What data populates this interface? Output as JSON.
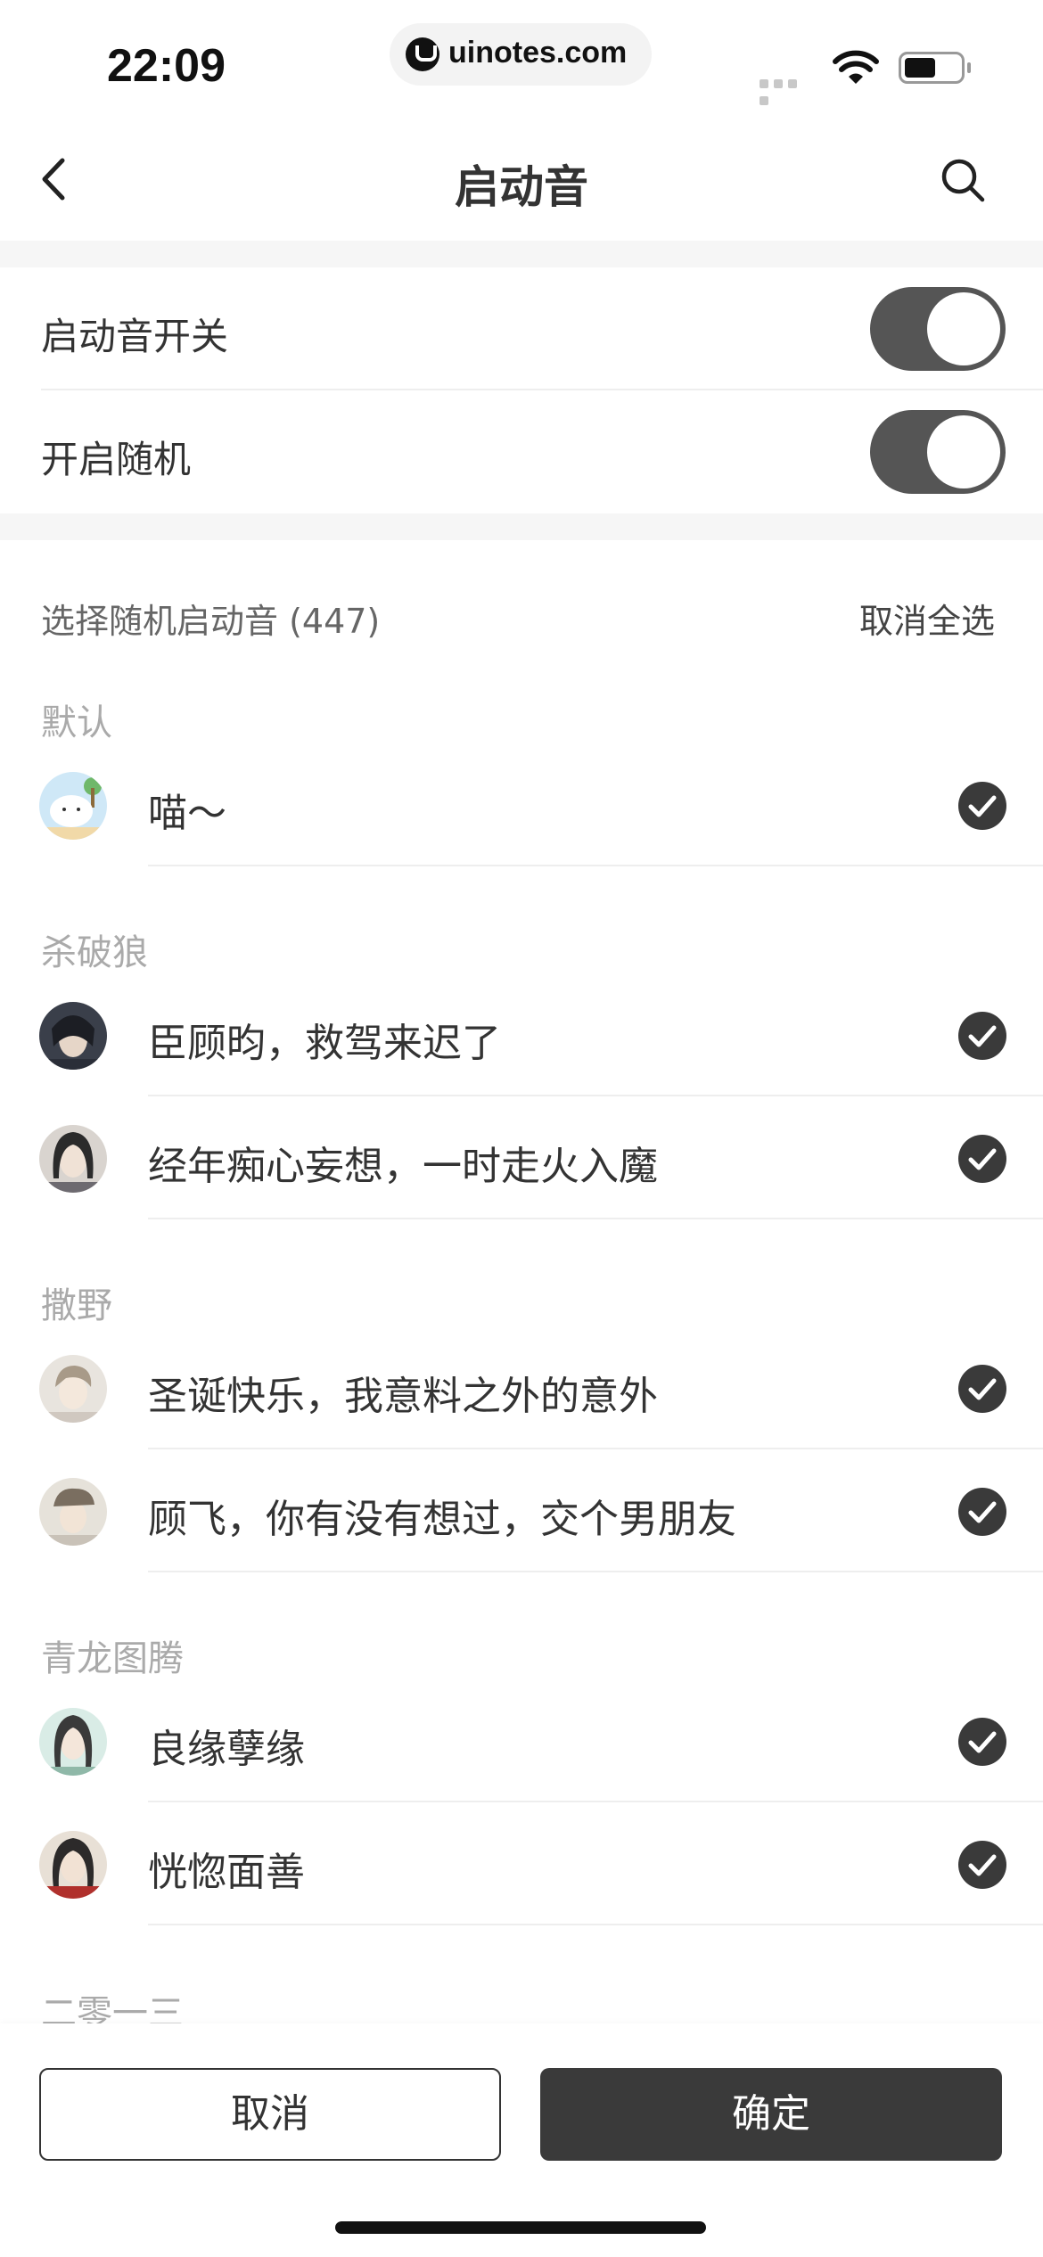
{
  "status_bar": {
    "time": "22:09",
    "url": "uinotes.com"
  },
  "nav": {
    "title": "启动音"
  },
  "settings": {
    "toggles": [
      {
        "label": "启动音开关",
        "on": true
      },
      {
        "label": "开启随机",
        "on": true
      }
    ]
  },
  "selection": {
    "header": "选择随机启动音 (447)",
    "deselect_all": "取消全选"
  },
  "groups": [
    {
      "title": "默认",
      "items": [
        {
          "text": "喵～",
          "checked": true
        }
      ]
    },
    {
      "title": "杀破狼",
      "items": [
        {
          "text": "臣顾昀，救驾来迟了",
          "checked": true
        },
        {
          "text": "经年痴心妄想，一时走火入魔",
          "checked": true
        }
      ]
    },
    {
      "title": "撒野",
      "items": [
        {
          "text": "圣诞快乐，我意料之外的意外",
          "checked": true
        },
        {
          "text": "顾飞，你有没有想过，交个男朋友",
          "checked": true
        }
      ]
    },
    {
      "title": "青龙图腾",
      "items": [
        {
          "text": "良缘孽缘",
          "checked": true
        },
        {
          "text": "恍惚面善",
          "checked": true
        }
      ]
    },
    {
      "title": "二零一三",
      "items": []
    }
  ],
  "footer": {
    "cancel": "取消",
    "confirm": "确定"
  },
  "colors": {
    "toggle_on": "#555555",
    "check": "#3a3a3a",
    "primary_button": "#3a3a3a"
  }
}
